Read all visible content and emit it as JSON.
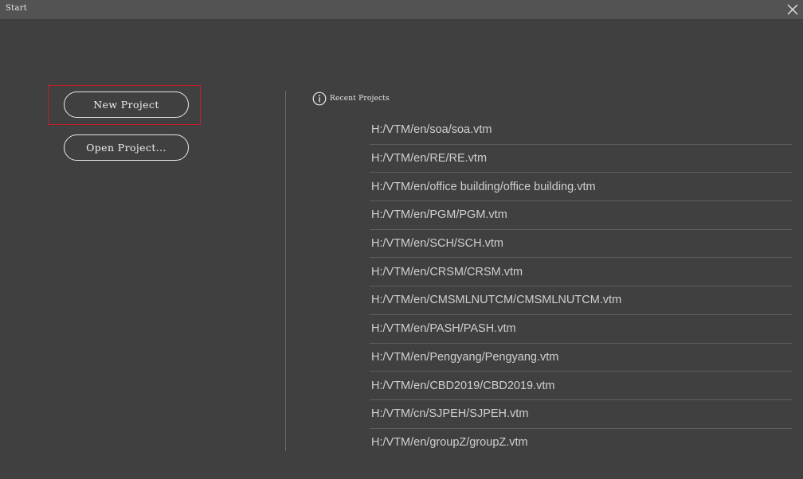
{
  "window": {
    "title": "Start",
    "close_icon": "close-icon"
  },
  "actions": {
    "new_project_label": "New Project",
    "open_project_label": "Open Project..."
  },
  "recent": {
    "icon": "info-icon",
    "title": "Recent Projects",
    "items": [
      "H:/VTM/en/soa/soa.vtm",
      "H:/VTM/en/RE/RE.vtm",
      "H:/VTM/en/office building/office building.vtm",
      "H:/VTM/en/PGM/PGM.vtm",
      "H:/VTM/en/SCH/SCH.vtm",
      "H:/VTM/en/CRSM/CRSM.vtm",
      "H:/VTM/en/CMSMLNUTCM/CMSMLNUTCM.vtm",
      "H:/VTM/en/PASH/PASH.vtm",
      "H:/VTM/en/Pengyang/Pengyang.vtm",
      "H:/VTM/en/CBD2019/CBD2019.vtm",
      "H:/VTM/cn/SJPEH/SJPEH.vtm",
      "H:/VTM/en/groupZ/groupZ.vtm"
    ]
  },
  "colors": {
    "background": "#404040",
    "titlebar": "#535353",
    "highlight": "#c2202a",
    "text": "#cfcfcf"
  }
}
